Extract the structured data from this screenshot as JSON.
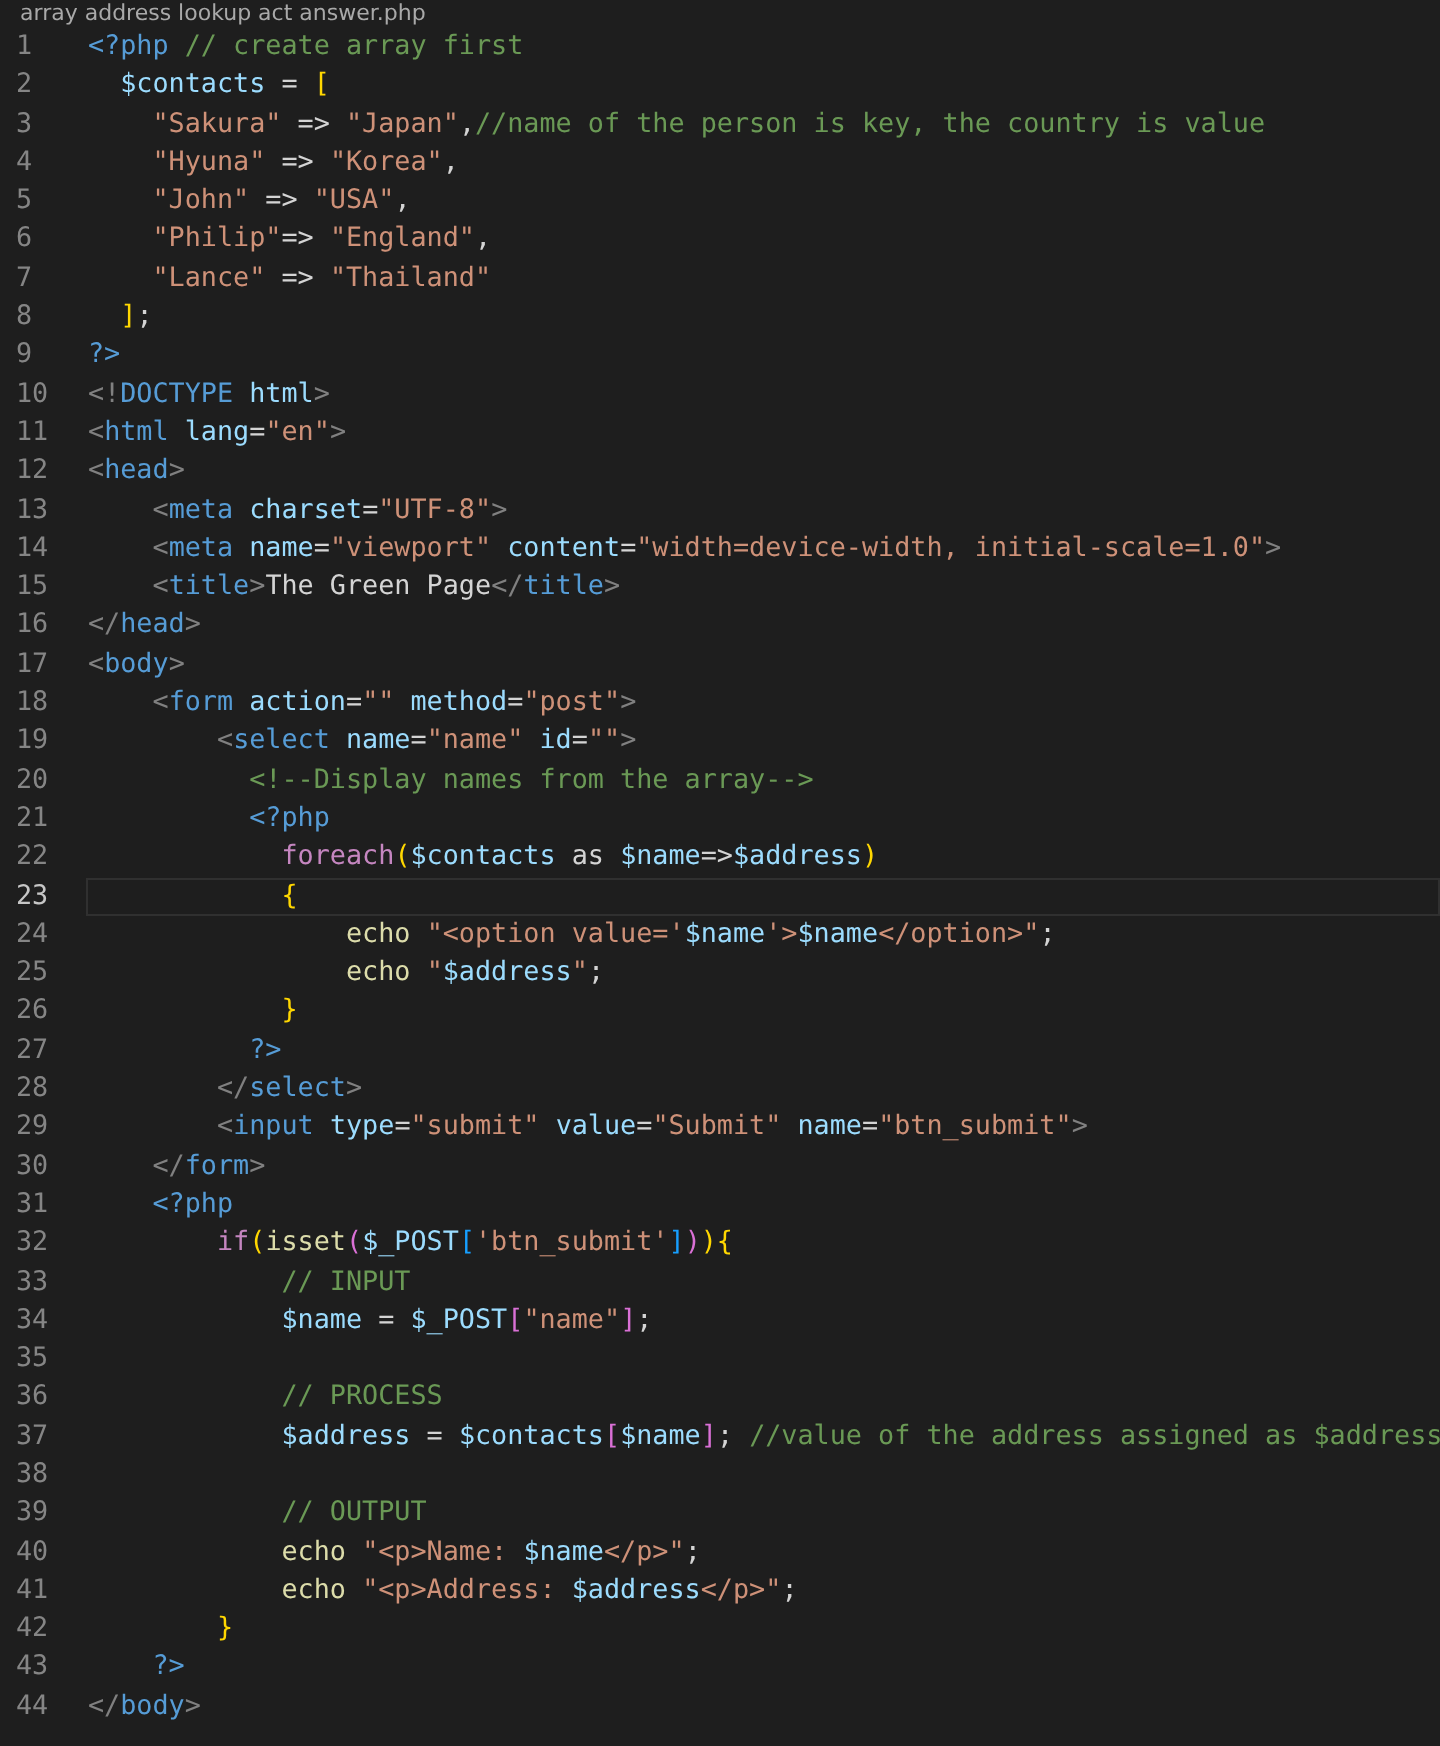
{
  "breadcrumb": "array address lookup act answer.php",
  "lines": [
    {
      "number": "1",
      "active": false,
      "tokens": [
        {
          "kind": "tag",
          "text": "<?php"
        },
        {
          "kind": "comment",
          "text": " // create array first"
        }
      ]
    },
    {
      "number": "2",
      "active": false,
      "tokens": [
        {
          "kind": "variable",
          "text": "  $contacts"
        },
        {
          "kind": "text",
          "text": " = "
        },
        {
          "kind": "bracket",
          "text": "["
        }
      ]
    },
    {
      "number": "3",
      "active": false,
      "tokens": [
        {
          "kind": "string",
          "text": "    \"Sakura\""
        },
        {
          "kind": "text",
          "text": " => "
        },
        {
          "kind": "string",
          "text": "\"Japan\""
        },
        {
          "kind": "text",
          "text": ","
        },
        {
          "kind": "comment",
          "text": "//name of the person is key, the country is value"
        }
      ]
    },
    {
      "number": "4",
      "active": false,
      "tokens": [
        {
          "kind": "string",
          "text": "    \"Hyuna\""
        },
        {
          "kind": "text",
          "text": " => "
        },
        {
          "kind": "string",
          "text": "\"Korea\""
        },
        {
          "kind": "text",
          "text": ","
        }
      ]
    },
    {
      "number": "5",
      "active": false,
      "tokens": [
        {
          "kind": "string",
          "text": "    \"John\""
        },
        {
          "kind": "text",
          "text": " => "
        },
        {
          "kind": "string",
          "text": "\"USA\""
        },
        {
          "kind": "text",
          "text": ","
        }
      ]
    },
    {
      "number": "6",
      "active": false,
      "tokens": [
        {
          "kind": "string",
          "text": "    \"Philip\""
        },
        {
          "kind": "text",
          "text": "=> "
        },
        {
          "kind": "string",
          "text": "\"England\""
        },
        {
          "kind": "text",
          "text": ","
        }
      ]
    },
    {
      "number": "7",
      "active": false,
      "tokens": [
        {
          "kind": "string",
          "text": "    \"Lance\""
        },
        {
          "kind": "text",
          "text": " => "
        },
        {
          "kind": "string",
          "text": "\"Thailand\""
        }
      ]
    },
    {
      "number": "8",
      "active": false,
      "tokens": [
        {
          "kind": "bracket",
          "text": "  ]"
        },
        {
          "kind": "text",
          "text": ";"
        }
      ]
    },
    {
      "number": "9",
      "active": false,
      "tokens": [
        {
          "kind": "tag",
          "text": "?>"
        }
      ]
    },
    {
      "number": "10",
      "active": false,
      "tokens": [
        {
          "kind": "punct",
          "text": "<!"
        },
        {
          "kind": "tag",
          "text": "DOCTYPE "
        },
        {
          "kind": "attr",
          "text": "html"
        },
        {
          "kind": "punct",
          "text": ">"
        }
      ]
    },
    {
      "number": "11",
      "active": false,
      "tokens": [
        {
          "kind": "punct",
          "text": "<"
        },
        {
          "kind": "tag",
          "text": "html "
        },
        {
          "kind": "attr",
          "text": "lang"
        },
        {
          "kind": "text",
          "text": "="
        },
        {
          "kind": "string",
          "text": "\"en\""
        },
        {
          "kind": "punct",
          "text": ">"
        }
      ]
    },
    {
      "number": "12",
      "active": false,
      "tokens": [
        {
          "kind": "punct",
          "text": "<"
        },
        {
          "kind": "tag",
          "text": "head"
        },
        {
          "kind": "punct",
          "text": ">"
        }
      ]
    },
    {
      "number": "13",
      "active": false,
      "tokens": [
        {
          "kind": "punct",
          "text": "    <"
        },
        {
          "kind": "tag",
          "text": "meta "
        },
        {
          "kind": "attr",
          "text": "charset"
        },
        {
          "kind": "text",
          "text": "="
        },
        {
          "kind": "string",
          "text": "\"UTF-8\""
        },
        {
          "kind": "punct",
          "text": ">"
        }
      ]
    },
    {
      "number": "14",
      "active": false,
      "tokens": [
        {
          "kind": "punct",
          "text": "    <"
        },
        {
          "kind": "tag",
          "text": "meta "
        },
        {
          "kind": "attr",
          "text": "name"
        },
        {
          "kind": "text",
          "text": "="
        },
        {
          "kind": "string",
          "text": "\"viewport\" "
        },
        {
          "kind": "attr",
          "text": "content"
        },
        {
          "kind": "text",
          "text": "="
        },
        {
          "kind": "string",
          "text": "\"width=device-width, initial-scale=1.0\""
        },
        {
          "kind": "punct",
          "text": ">"
        }
      ]
    },
    {
      "number": "15",
      "active": false,
      "tokens": [
        {
          "kind": "punct",
          "text": "    <"
        },
        {
          "kind": "tag",
          "text": "title"
        },
        {
          "kind": "punct",
          "text": ">"
        },
        {
          "kind": "text",
          "text": "The Green Page"
        },
        {
          "kind": "punct",
          "text": "</"
        },
        {
          "kind": "tag",
          "text": "title"
        },
        {
          "kind": "punct",
          "text": ">"
        }
      ]
    },
    {
      "number": "16",
      "active": false,
      "tokens": [
        {
          "kind": "punct",
          "text": "</"
        },
        {
          "kind": "tag",
          "text": "head"
        },
        {
          "kind": "punct",
          "text": ">"
        }
      ]
    },
    {
      "number": "17",
      "active": false,
      "tokens": [
        {
          "kind": "punct",
          "text": "<"
        },
        {
          "kind": "tag",
          "text": "body"
        },
        {
          "kind": "punct",
          "text": ">"
        }
      ]
    },
    {
      "number": "18",
      "active": false,
      "tokens": [
        {
          "kind": "punct",
          "text": "    <"
        },
        {
          "kind": "tag",
          "text": "form "
        },
        {
          "kind": "attr",
          "text": "action"
        },
        {
          "kind": "text",
          "text": "="
        },
        {
          "kind": "string",
          "text": "\"\" "
        },
        {
          "kind": "attr",
          "text": "method"
        },
        {
          "kind": "text",
          "text": "="
        },
        {
          "kind": "string",
          "text": "\"post\""
        },
        {
          "kind": "punct",
          "text": ">"
        }
      ]
    },
    {
      "number": "19",
      "active": false,
      "tokens": [
        {
          "kind": "punct",
          "text": "        <"
        },
        {
          "kind": "tag",
          "text": "select "
        },
        {
          "kind": "attr",
          "text": "name"
        },
        {
          "kind": "text",
          "text": "="
        },
        {
          "kind": "string",
          "text": "\"name\" "
        },
        {
          "kind": "attr",
          "text": "id"
        },
        {
          "kind": "text",
          "text": "="
        },
        {
          "kind": "string",
          "text": "\"\""
        },
        {
          "kind": "punct",
          "text": ">"
        }
      ]
    },
    {
      "number": "20",
      "active": false,
      "tokens": [
        {
          "kind": "comment",
          "text": "          <!--Display names from the array-->"
        }
      ]
    },
    {
      "number": "21",
      "active": false,
      "tokens": [
        {
          "kind": "tag",
          "text": "          <?php"
        }
      ]
    },
    {
      "number": "22",
      "active": false,
      "tokens": [
        {
          "kind": "keyword",
          "text": "            foreach"
        },
        {
          "kind": "bracket",
          "text": "("
        },
        {
          "kind": "variable",
          "text": "$contacts"
        },
        {
          "kind": "text",
          "text": " as "
        },
        {
          "kind": "variable",
          "text": "$name"
        },
        {
          "kind": "text",
          "text": "=>"
        },
        {
          "kind": "variable",
          "text": "$address"
        },
        {
          "kind": "bracket",
          "text": ")"
        }
      ]
    },
    {
      "number": "23",
      "active": true,
      "tokens": [
        {
          "kind": "bracket",
          "text": "            {"
        }
      ]
    },
    {
      "number": "24",
      "active": false,
      "tokens": [
        {
          "kind": "function",
          "text": "                echo "
        },
        {
          "kind": "string",
          "text": "\"<option value='"
        },
        {
          "kind": "variable",
          "text": "$name"
        },
        {
          "kind": "string",
          "text": "'>"
        },
        {
          "kind": "variable",
          "text": "$name"
        },
        {
          "kind": "string",
          "text": "</option>\""
        },
        {
          "kind": "text",
          "text": ";"
        }
      ]
    },
    {
      "number": "25",
      "active": false,
      "tokens": [
        {
          "kind": "function",
          "text": "                echo "
        },
        {
          "kind": "string",
          "text": "\""
        },
        {
          "kind": "variable",
          "text": "$address"
        },
        {
          "kind": "string",
          "text": "\""
        },
        {
          "kind": "text",
          "text": ";"
        }
      ]
    },
    {
      "number": "26",
      "active": false,
      "tokens": [
        {
          "kind": "bracket",
          "text": "            }"
        }
      ]
    },
    {
      "number": "27",
      "active": false,
      "tokens": [
        {
          "kind": "tag",
          "text": "          ?>"
        }
      ]
    },
    {
      "number": "28",
      "active": false,
      "tokens": [
        {
          "kind": "punct",
          "text": "        </"
        },
        {
          "kind": "tag",
          "text": "select"
        },
        {
          "kind": "punct",
          "text": ">"
        }
      ]
    },
    {
      "number": "29",
      "active": false,
      "tokens": [
        {
          "kind": "punct",
          "text": "        <"
        },
        {
          "kind": "tag",
          "text": "input "
        },
        {
          "kind": "attr",
          "text": "type"
        },
        {
          "kind": "text",
          "text": "="
        },
        {
          "kind": "string",
          "text": "\"submit\" "
        },
        {
          "kind": "attr",
          "text": "value"
        },
        {
          "kind": "text",
          "text": "="
        },
        {
          "kind": "string",
          "text": "\"Submit\" "
        },
        {
          "kind": "attr",
          "text": "name"
        },
        {
          "kind": "text",
          "text": "="
        },
        {
          "kind": "string",
          "text": "\"btn_submit\""
        },
        {
          "kind": "punct",
          "text": ">"
        }
      ]
    },
    {
      "number": "30",
      "active": false,
      "tokens": [
        {
          "kind": "punct",
          "text": "    </"
        },
        {
          "kind": "tag",
          "text": "form"
        },
        {
          "kind": "punct",
          "text": ">"
        }
      ]
    },
    {
      "number": "31",
      "active": false,
      "tokens": [
        {
          "kind": "tag",
          "text": "    <?php"
        }
      ]
    },
    {
      "number": "32",
      "active": false,
      "tokens": [
        {
          "kind": "keyword",
          "text": "        if"
        },
        {
          "kind": "bracket",
          "text": "("
        },
        {
          "kind": "function",
          "text": "isset"
        },
        {
          "kind": "subbracket",
          "text": "("
        },
        {
          "kind": "variable",
          "text": "$_POST"
        },
        {
          "kind": "innerbracket",
          "text": "["
        },
        {
          "kind": "string",
          "text": "'btn_submit'"
        },
        {
          "kind": "innerbracket",
          "text": "]"
        },
        {
          "kind": "subbracket",
          "text": ")"
        },
        {
          "kind": "bracket",
          "text": "){"
        }
      ]
    },
    {
      "number": "33",
      "active": false,
      "tokens": [
        {
          "kind": "comment",
          "text": "            // INPUT"
        }
      ]
    },
    {
      "number": "34",
      "active": false,
      "tokens": [
        {
          "kind": "variable",
          "text": "            $name"
        },
        {
          "kind": "text",
          "text": " = "
        },
        {
          "kind": "variable",
          "text": "$_POST"
        },
        {
          "kind": "subbracket",
          "text": "["
        },
        {
          "kind": "string",
          "text": "\"name\""
        },
        {
          "kind": "subbracket",
          "text": "]"
        },
        {
          "kind": "text",
          "text": ";"
        }
      ]
    },
    {
      "number": "35",
      "active": false
    },
    {
      "number": "36",
      "active": false,
      "tokens": [
        {
          "kind": "comment",
          "text": "            // PROCESS"
        }
      ]
    },
    {
      "number": "37",
      "active": false,
      "tokens": [
        {
          "kind": "variable",
          "text": "            $address"
        },
        {
          "kind": "text",
          "text": " = "
        },
        {
          "kind": "variable",
          "text": "$contacts"
        },
        {
          "kind": "subbracket",
          "text": "["
        },
        {
          "kind": "variable",
          "text": "$name"
        },
        {
          "kind": "subbracket",
          "text": "]"
        },
        {
          "kind": "text",
          "text": "; "
        },
        {
          "kind": "comment",
          "text": "//value of the address assigned as $address"
        }
      ]
    },
    {
      "number": "38",
      "active": false
    },
    {
      "number": "39",
      "active": false,
      "tokens": [
        {
          "kind": "comment",
          "text": "            // OUTPUT"
        }
      ]
    },
    {
      "number": "40",
      "active": false,
      "tokens": [
        {
          "kind": "function",
          "text": "            echo "
        },
        {
          "kind": "string",
          "text": "\"<p>Name: "
        },
        {
          "kind": "variable",
          "text": "$name"
        },
        {
          "kind": "string",
          "text": "</p>\""
        },
        {
          "kind": "text",
          "text": ";"
        }
      ]
    },
    {
      "number": "41",
      "active": false,
      "tokens": [
        {
          "kind": "function",
          "text": "            echo "
        },
        {
          "kind": "string",
          "text": "\"<p>Address: "
        },
        {
          "kind": "variable",
          "text": "$address"
        },
        {
          "kind": "string",
          "text": "</p>\""
        },
        {
          "kind": "text",
          "text": ";"
        }
      ]
    },
    {
      "number": "42",
      "active": false,
      "tokens": [
        {
          "kind": "bracket",
          "text": "        }"
        }
      ]
    },
    {
      "number": "43",
      "active": false,
      "tokens": [
        {
          "kind": "tag",
          "text": "    ?>"
        }
      ]
    },
    {
      "number": "44",
      "active": false,
      "tokens": [
        {
          "kind": "punct",
          "text": "</"
        },
        {
          "kind": "tag",
          "text": "body"
        },
        {
          "kind": "punct",
          "text": ">"
        }
      ]
    }
  ]
}
